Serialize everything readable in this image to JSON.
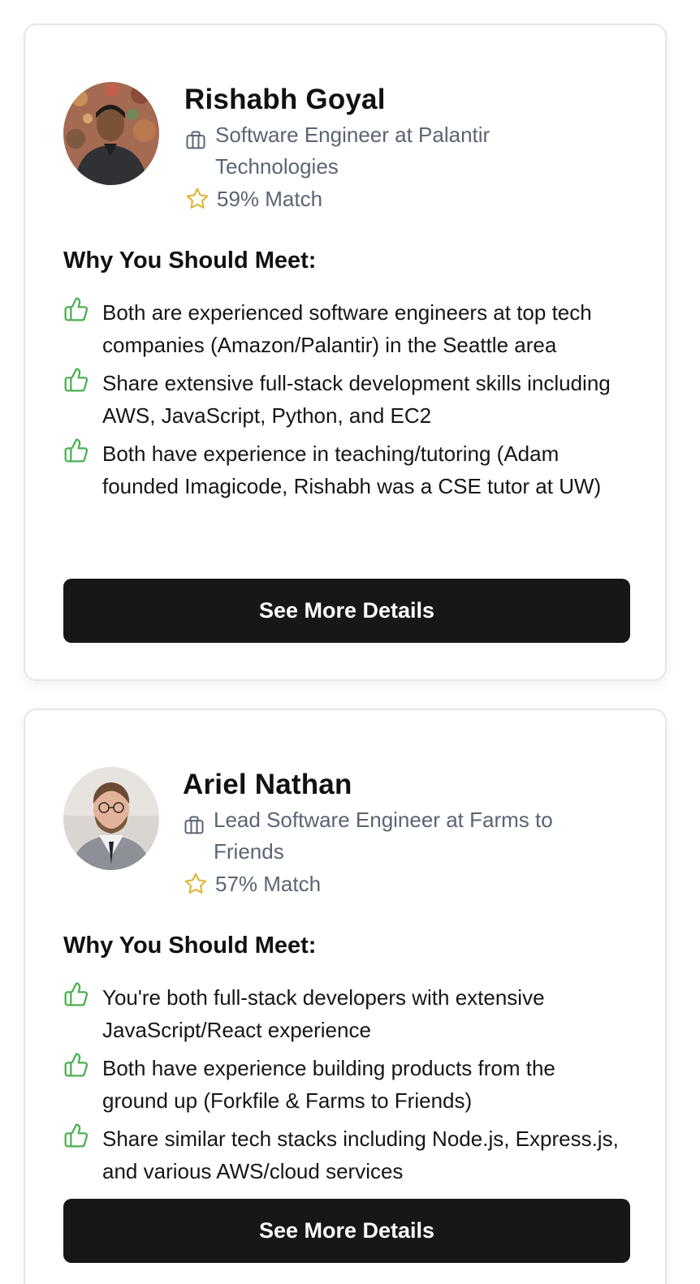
{
  "matches": [
    {
      "name": "Rishabh Goyal",
      "role": "Software Engineer at Palantir Technologies",
      "match": "59% Match",
      "why_title": "Why You Should Meet:",
      "reasons": [
        "Both are experienced software engineers at top tech companies (Amazon/Palantir) in the Seattle area",
        "Share extensive full-stack development skills including AWS, JavaScript, Python, and EC2",
        "Both have experience in teaching/tutoring (Adam founded Imagicode, Rishabh was a CSE tutor at UW)"
      ],
      "button_label": "See More Details"
    },
    {
      "name": "Ariel Nathan",
      "role": "Lead Software Engineer at Farms to Friends",
      "match": "57% Match",
      "why_title": "Why You Should Meet:",
      "reasons": [
        "You're both full-stack developers with extensive JavaScript/React experience",
        "Both have experience building products from the ground up (Forkfile & Farms to Friends)",
        "Share similar tech stacks including Node.js, Express.js, and various AWS/cloud services"
      ],
      "button_label": "See More Details"
    }
  ],
  "icons": {
    "role": "briefcase-icon",
    "match": "star-icon",
    "reason": "thumbs-up-icon"
  },
  "colors": {
    "accent_green": "#4caf50",
    "star_gold": "#e0b43a",
    "muted_text": "#5b6474",
    "button_bg": "#171717"
  }
}
